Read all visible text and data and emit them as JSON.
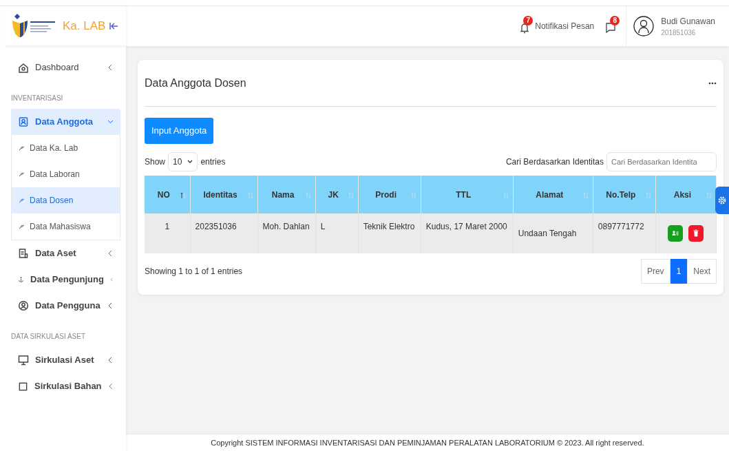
{
  "brand": {
    "title": "Ka. LAB"
  },
  "topbar": {
    "notification_count": "7",
    "messages": {
      "label": "Notifikasi Pesan",
      "count": "8"
    },
    "user": {
      "name": "Budi Gunawan",
      "id": "201851036"
    }
  },
  "sidebar": {
    "sections": [
      {
        "items": [
          {
            "label": "Dashboard",
            "selected": false,
            "expanded": false
          }
        ]
      },
      {
        "header": "INVENTARISASI",
        "items": [
          {
            "label": "Data Anggota",
            "selected": true,
            "expanded": true,
            "children": [
              {
                "label": "Data Ka. Lab",
                "selected": false
              },
              {
                "label": "Data Laboran",
                "selected": false
              },
              {
                "label": "Data Dosen",
                "selected": true
              },
              {
                "label": "Data Mahasiswa",
                "selected": false
              }
            ]
          },
          {
            "label": "Data Aset",
            "selected": false,
            "expanded": false
          },
          {
            "label": "Data Pengunjung",
            "selected": false,
            "expanded": false
          },
          {
            "label": "Data Pengguna",
            "selected": false,
            "expanded": false
          }
        ]
      },
      {
        "header": "DATA SIRKULASI ASET",
        "items": [
          {
            "label": "Sirkulasi Aset",
            "selected": false,
            "expanded": false
          },
          {
            "label": "Sirkulasi Bahan",
            "selected": false,
            "expanded": false
          }
        ]
      }
    ]
  },
  "card": {
    "title": "Data Anggota Dosen",
    "add_button": "Input Anggota",
    "length": {
      "before": "Show",
      "value": "10",
      "after": "entries"
    },
    "search": {
      "label": "Cari Berdasarkan Identitas",
      "placeholder": "Cari Berdasarkan Identita"
    },
    "table": {
      "columns": [
        {
          "label": "NO",
          "sorted": true
        },
        {
          "label": "Identitas",
          "sorted": false
        },
        {
          "label": "Nama",
          "sorted": false
        },
        {
          "label": "JK",
          "sorted": false
        },
        {
          "label": "Prodi",
          "sorted": false
        },
        {
          "label": "TTL",
          "sorted": false
        },
        {
          "label": "Alamat",
          "sorted": false
        },
        {
          "label": "No.Telp",
          "sorted": false
        },
        {
          "label": "Aksi",
          "sorted": false
        }
      ],
      "rows": [
        {
          "cells": [
            "1",
            "202351036",
            "Moh. Dahlan",
            "L",
            "Teknik Elektro",
            "Kudus, 17 Maret 2000",
            "Undaan Tengah",
            "0897771772"
          ]
        }
      ]
    },
    "info": "Showing 1 to 1 of 1 entries",
    "pagination": [
      {
        "label": "Prev",
        "selected": false
      },
      {
        "label": "1",
        "selected": true
      },
      {
        "label": "Next",
        "selected": false
      }
    ]
  },
  "footer": "Copyright SISTEM INFORMASI INVENTARISASI DAN PEMINJAMAN PERALATAN LABORATORIUM © 2023. All right reserved."
}
